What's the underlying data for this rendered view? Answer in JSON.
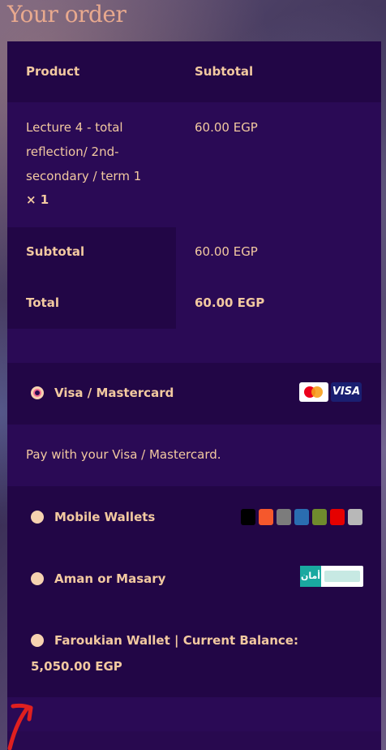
{
  "page": {
    "title": "Your order"
  },
  "table": {
    "headers": {
      "product": "Product",
      "subtotal": "Subtotal"
    },
    "item": {
      "name": "Lecture 4 - total reflection/ 2nd-secondary / term 1",
      "qty": "× 1",
      "price": "60.00 EGP"
    },
    "subtotal": {
      "label": "Subtotal",
      "value": "60.00 EGP"
    },
    "total": {
      "label": "Total",
      "value": "60.00 EGP"
    }
  },
  "payment": {
    "visa": {
      "label": "Visa / Mastercard",
      "desc": "Pay with your Visa / Mastercard.",
      "selected": true,
      "visa_mark": "VISA"
    },
    "wallets": {
      "label": "Mobile Wallets"
    },
    "aman": {
      "label": "Aman or Masary",
      "logo_text": "أمان"
    },
    "faroukian": {
      "label": "Faroukian Wallet | Current Balance:",
      "balance": "5,050.00 EGP"
    }
  },
  "colors": {
    "accent_text": "#f2c9a0",
    "panel_bg": "#28094f",
    "radio_selected": "#f26b93",
    "arrow": "#e0201f"
  }
}
